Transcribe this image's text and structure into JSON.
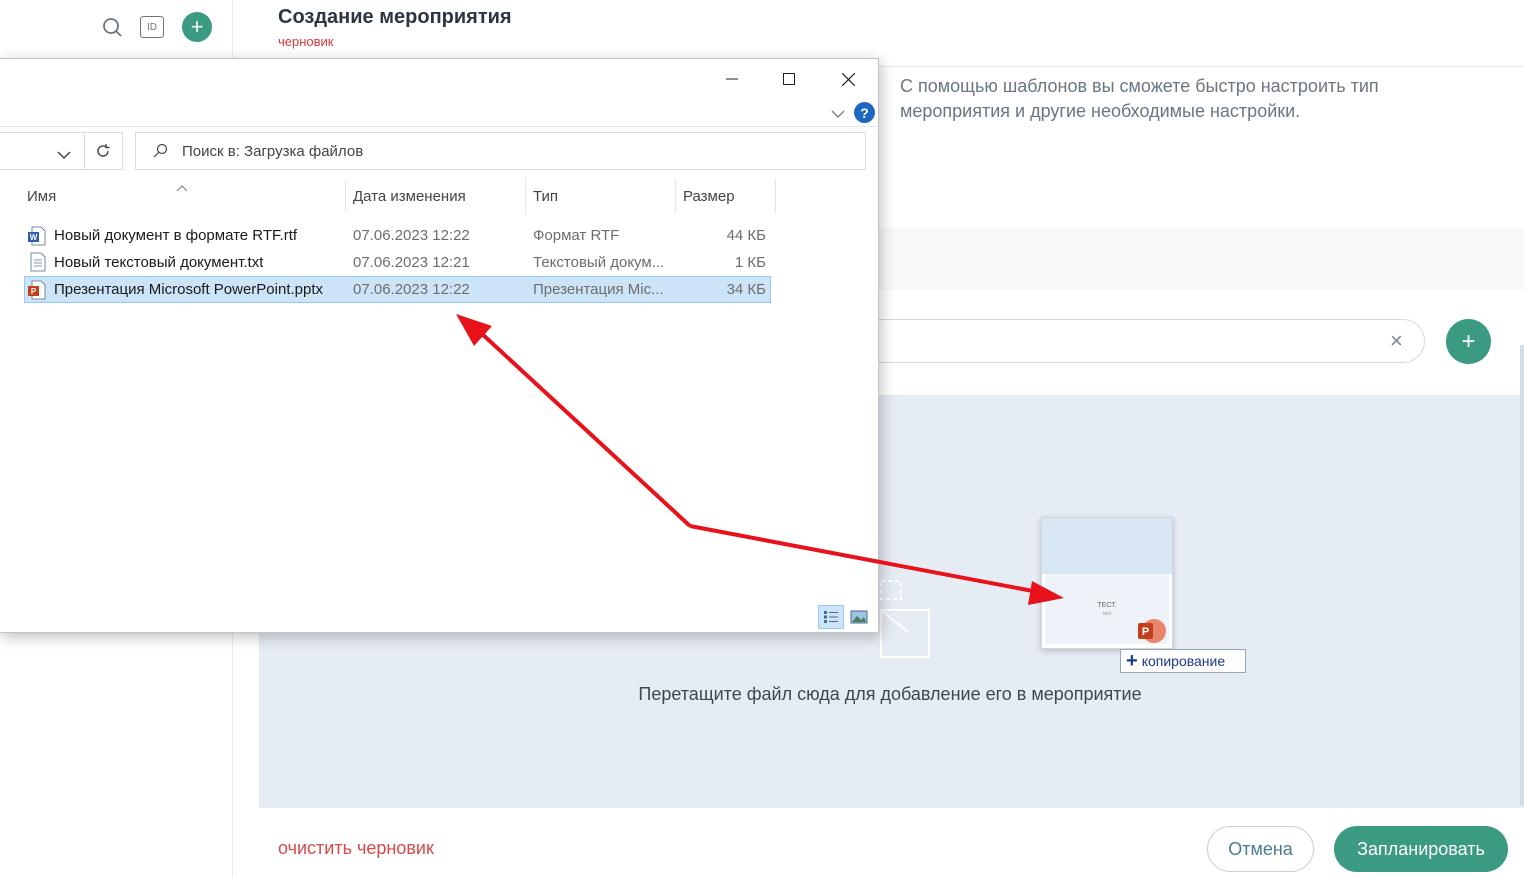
{
  "header": {
    "title": "Создание мероприятия",
    "status": "черновик"
  },
  "toolbar": {
    "search_icon": "search-icon",
    "id_label": "ID",
    "add_icon": "+"
  },
  "templates": {
    "description": "С помощью шаблонов вы сможете быстро настроить тип мероприятия и другие необходимые настройки."
  },
  "search": {
    "clear_icon": "×",
    "add_icon": "+"
  },
  "dropzone": {
    "hint": "Перетащите файл сюда для добавление его в мероприятие",
    "preview_title": "ТЕСТ.",
    "preview_sub": "text",
    "copy_label": "копирование"
  },
  "footer": {
    "clear_draft": "очистить черновик",
    "cancel": "Отмена",
    "plan": "Запланировать"
  },
  "dialog": {
    "search_placeholder": "Поиск в: Загрузка файлов",
    "columns": {
      "name": "Имя",
      "date": "Дата изменения",
      "type": "Тип",
      "size": "Размер"
    },
    "files": [
      {
        "name": "Новый документ в формате RTF.rtf",
        "date": "07.06.2023 12:22",
        "type": "Формат RTF",
        "size": "44 КБ",
        "icon": "word-doc-icon"
      },
      {
        "name": "Новый текстовый документ.txt",
        "date": "07.06.2023 12:21",
        "type": "Текстовый докум...",
        "size": "1 КБ",
        "icon": "text-file-icon"
      },
      {
        "name": "Презентация Microsoft PowerPoint.pptx",
        "date": "07.06.2023 12:22",
        "type": "Презентация Mic...",
        "size": "34 КБ",
        "icon": "powerpoint-file-icon",
        "selected": true
      }
    ]
  },
  "colors": {
    "accent": "#3a9a82",
    "danger": "#d94848",
    "dropzone_bg": "#e6ecf3",
    "selection": "#cce4f7",
    "arrow": "#e8121b"
  }
}
